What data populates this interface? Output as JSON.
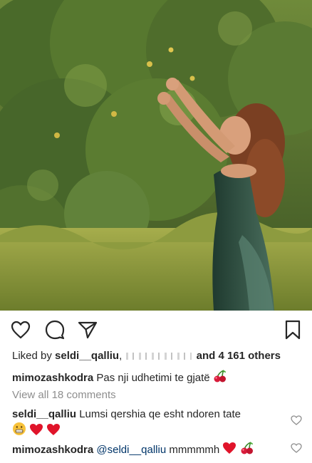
{
  "post": {
    "photo_alt": "",
    "liked_by_prefix": "Liked by",
    "liked_by_user": "seldi__qalliu",
    "liked_by_separator": ",",
    "liked_by_others": "and 4 161 others",
    "author": "mimozashkodra",
    "caption": "Pas nji udhetimi te gjatë",
    "caption_emoji": "cherries",
    "view_comments": "View all 18 comments"
  },
  "comments": [
    {
      "user": "seldi__qalliu",
      "text": "Lumsi qershia qe esht ndoren tate",
      "emojis": [
        "grimacing-face",
        "red-heart",
        "red-heart"
      ]
    },
    {
      "user": "mimozashkodra",
      "mention": "@seldi__qalliu",
      "text": "mmmmmh",
      "emojis": [
        "red-heart",
        "cherries"
      ]
    }
  ],
  "icons": {
    "like": "heart-outline-icon",
    "comment": "comment-bubble-icon",
    "share": "paper-plane-icon",
    "save": "bookmark-icon"
  },
  "colors": {
    "text": "#262626",
    "muted": "#8e8e8e",
    "mention": "#003569",
    "heart": "#e0245e"
  }
}
